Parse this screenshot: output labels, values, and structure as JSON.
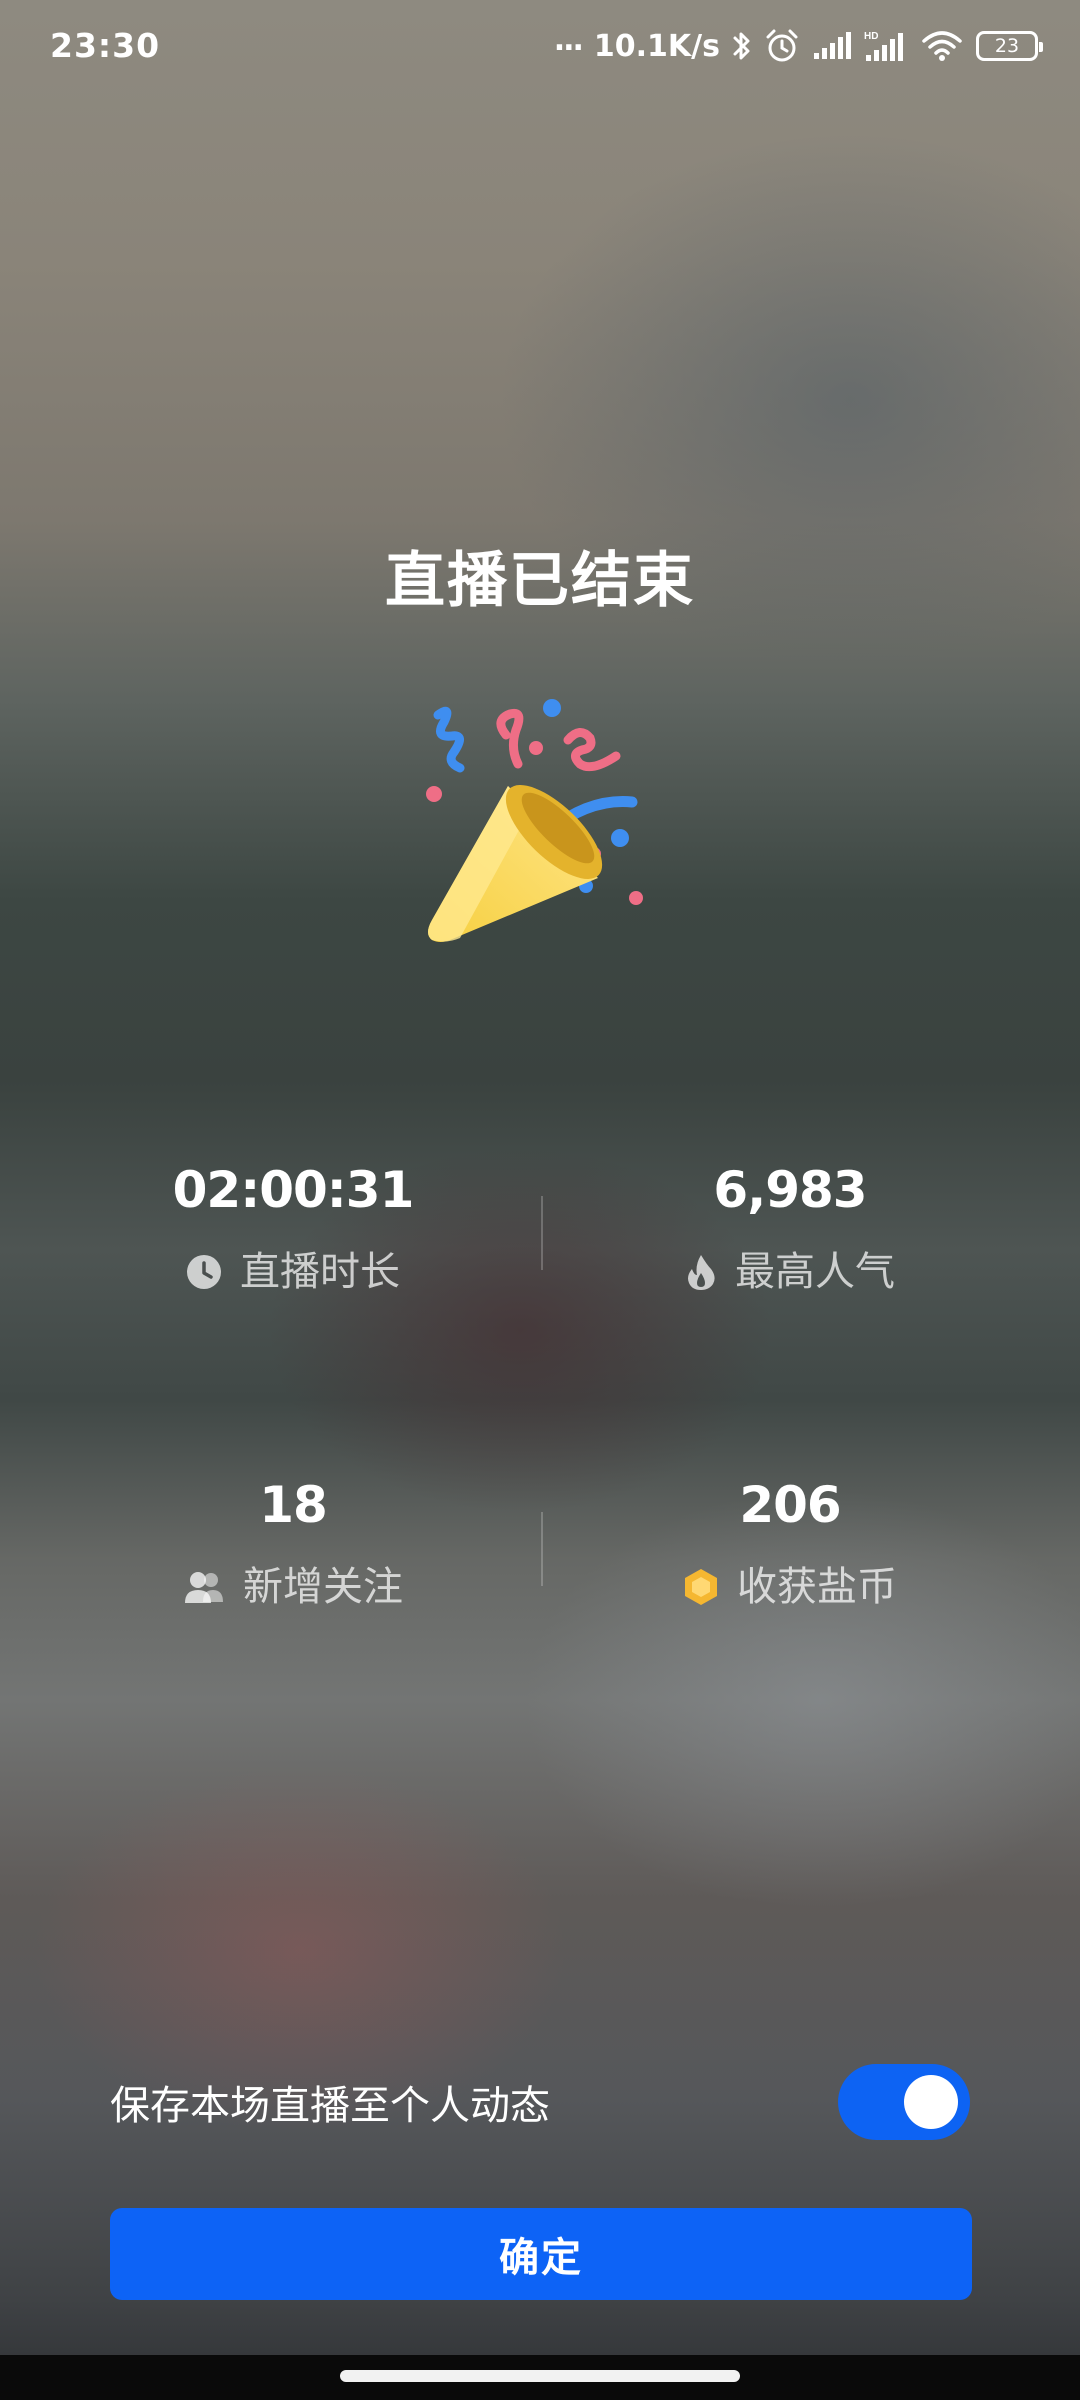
{
  "status_bar": {
    "time": "23:30",
    "dots": "...",
    "speed": "10.1K/s",
    "battery": "23",
    "icons": [
      "bluetooth-icon",
      "alarm-icon",
      "signal-icon",
      "hd-signal-icon",
      "wifi-icon",
      "battery-icon"
    ]
  },
  "title": "直播已结束",
  "celebration_icon": "party-popper-icon",
  "stats": [
    {
      "value": "02:00:31",
      "label": "直播时长",
      "icon": "clock-icon"
    },
    {
      "value": "6,983",
      "label": "最高人气",
      "icon": "flame-icon"
    },
    {
      "value": "18",
      "label": "新增关注",
      "icon": "users-icon"
    },
    {
      "value": "206",
      "label": "收获盐币",
      "icon": "coin-icon"
    }
  ],
  "save_option": {
    "label": "保存本场直播至个人动态",
    "enabled": true
  },
  "confirm_label": "确定",
  "colors": {
    "accent": "#0d63f6",
    "coin": "#f5b731"
  }
}
